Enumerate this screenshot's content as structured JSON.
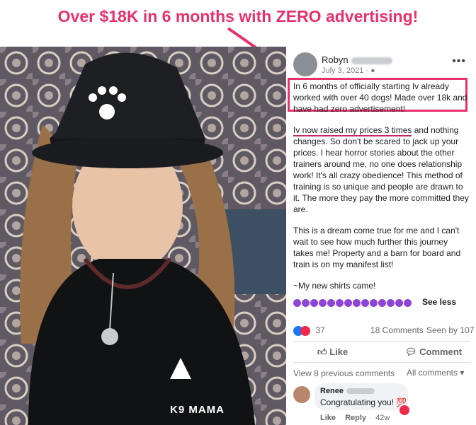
{
  "headline": "Over $18K in 6 months with ZERO advertising!",
  "post": {
    "author": "Robyn",
    "date": "July 3, 2021 · ",
    "more_icon": "ellipsis-icon",
    "highlighted_text": "In 6 months of officially starting Iv already worked with over 40 dogs! Made over 18k and have had zero advertisement!",
    "para2_underlined": "Iv now raised my prices 3 times",
    "para2_rest": " and nothing changes. So don't be scared to jack up your prices. I hear horror stories about the other trainers around me, no one does relationship work! It's all crazy obedience! This method of training is so unique and people are drawn to it. The more they pay the more committed they are.",
    "para3": "This is a dream come true for me and I can't wait to see how much further this journey takes me! Property and a barn for board and train is on my manifest list!",
    "para4": "~My new shirts came!",
    "see_less": "See less",
    "reactions_count": "37",
    "comments_count": "18 Comments",
    "seen_by": "Seen by 107",
    "like_label": "Like",
    "comment_label": "Comment",
    "prev_comments": "View 8 previous comments",
    "all_comments": "All comments ▾"
  },
  "comment": {
    "name": "Renee",
    "text": "Congratulating you! 💯",
    "like": "Like",
    "reply": "Reply",
    "time": "42w"
  },
  "photo": {
    "shirt_text": "K9 MAMA"
  },
  "colors": {
    "accent": "#e8316c",
    "facebook_blue": "#1877f2"
  }
}
